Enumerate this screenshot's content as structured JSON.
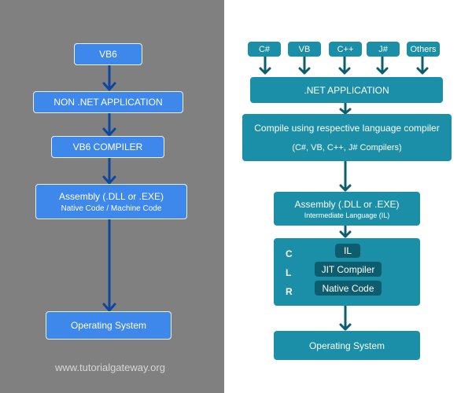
{
  "left": {
    "boxes": {
      "vb6": "VB6",
      "non_net": "NON .NET APPLICATION",
      "compiler": "VB6 COMPILER",
      "assembly": "Assembly (.DLL or .EXE)",
      "assembly_sub": "Native Code / Machine Code",
      "os": "Operating System"
    },
    "watermark": "www.tutorialgateway.org"
  },
  "right": {
    "languages": [
      "C#",
      "VB",
      "C++",
      "J#",
      "Others"
    ],
    "boxes": {
      "net_app": ".NET APPLICATION",
      "compile": "Compile using respective language compiler",
      "compile_sub": "(C#, VB, C++, J# Compilers)",
      "assembly": "Assembly (.DLL or .EXE)",
      "assembly_sub": "Intermediate Language (IL)",
      "os": "Operating System"
    },
    "clr": {
      "letters": [
        "C",
        "L",
        "R"
      ],
      "steps": [
        "IL",
        "JIT Compiler",
        "Native Code"
      ]
    }
  },
  "colors": {
    "left_bg": "#808080",
    "left_box": "#3d88ea",
    "left_arrow": "#0d47a1",
    "right_box": "#1a8fa7",
    "right_arrow": "#0e5d6e",
    "clr_inner": "#0e5d6e"
  }
}
